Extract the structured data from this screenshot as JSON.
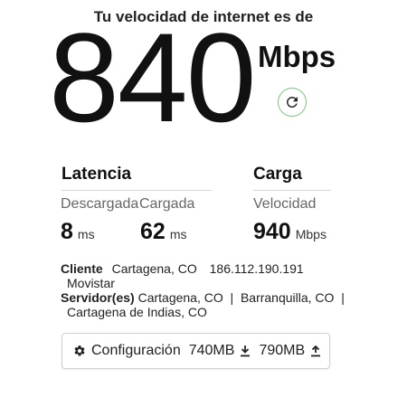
{
  "headline": "Tu velocidad de internet es de",
  "download": {
    "value": "840",
    "unit": "Mbps"
  },
  "latency": {
    "title": "Latencia",
    "unloaded_label": "Descargada",
    "loaded_label": "Cargada",
    "unloaded_value": "8",
    "loaded_value": "62",
    "unit": "ms"
  },
  "upload": {
    "title": "Carga",
    "speed_label": "Velocidad",
    "value": "940",
    "unit": "Mbps"
  },
  "client": {
    "label": "Cliente",
    "location": "Cartagena, CO",
    "ip": "186.112.190.191",
    "isp": "Movistar"
  },
  "servers": {
    "label": "Servidor(es)",
    "line1": "Cartagena, CO  |  Barranquilla, CO  |",
    "line2": "Cartagena de Indias, CO"
  },
  "config": {
    "label": "Configuración",
    "download_size": "740MB",
    "upload_size": "790MB"
  },
  "icons": {
    "refresh": "refresh-icon",
    "gear": "gear-icon",
    "download": "download-icon",
    "upload": "upload-icon"
  },
  "colors": {
    "refresh_ring": "#7cc47c",
    "text": "#222222",
    "muted": "#666666"
  }
}
